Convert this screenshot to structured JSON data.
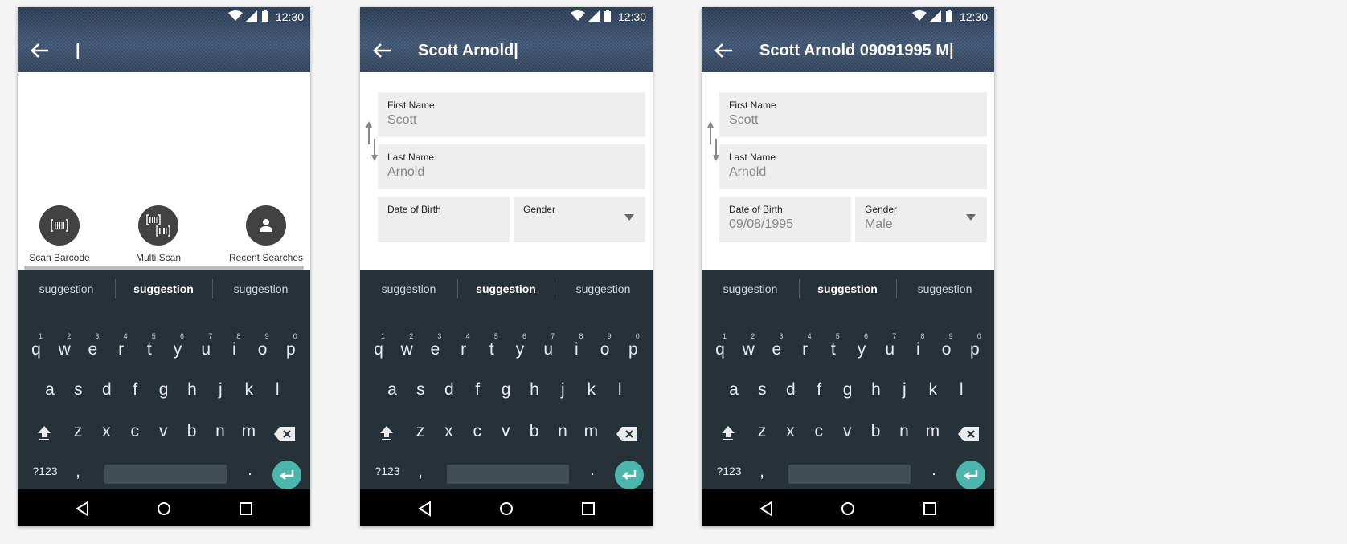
{
  "status": {
    "time": "12:30"
  },
  "screens": [
    {
      "title": "",
      "actions": [
        {
          "label": "Scan Barcode",
          "icon": "barcode-icon"
        },
        {
          "label": "Multi Scan",
          "icon": "multi-barcode-icon"
        },
        {
          "label": "Recent Searches",
          "icon": "person-icon"
        }
      ]
    },
    {
      "title": "Scott Arnold",
      "fields": {
        "first_name_label": "First Name",
        "first_name": "Scott",
        "last_name_label": "Last Name",
        "last_name": "Arnold",
        "dob_label": "Date of Birth",
        "dob": "",
        "gender_label": "Gender",
        "gender": ""
      }
    },
    {
      "title": "Scott Arnold 09091995 M",
      "fields": {
        "first_name_label": "First Name",
        "first_name": "Scott",
        "last_name_label": "Last Name",
        "last_name": "Arnold",
        "dob_label": "Date of Birth",
        "dob": "09/08/1995",
        "gender_label": "Gender",
        "gender": "Male"
      }
    }
  ],
  "keyboard": {
    "suggestions": [
      "suggestion",
      "suggestion",
      "suggestion"
    ],
    "row1": [
      "q",
      "w",
      "e",
      "r",
      "t",
      "y",
      "u",
      "i",
      "o",
      "p"
    ],
    "row1_nums": [
      "1",
      "2",
      "3",
      "4",
      "5",
      "6",
      "7",
      "8",
      "9",
      "0"
    ],
    "row2": [
      "a",
      "s",
      "d",
      "f",
      "g",
      "h",
      "j",
      "k",
      "l"
    ],
    "row3": [
      "z",
      "x",
      "c",
      "v",
      "b",
      "n",
      "m"
    ],
    "symbols_key": "?123",
    "comma_key": ",",
    "period_key": "."
  }
}
